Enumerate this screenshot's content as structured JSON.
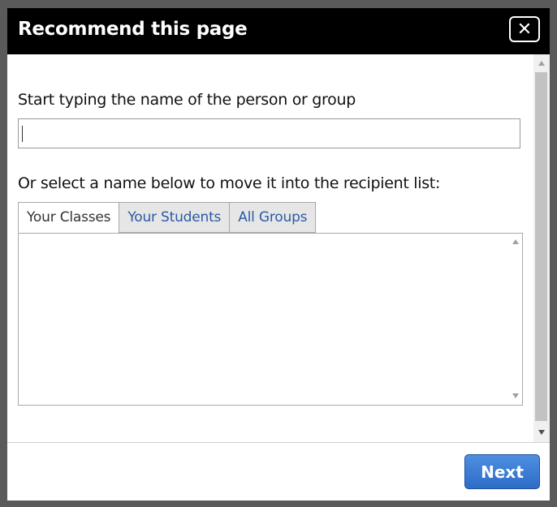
{
  "modal": {
    "title": "Recommend this page",
    "close_icon": "close-icon",
    "close_glyph": "✕",
    "prompt_label": "Start typing the name of the person or group",
    "search": {
      "value": "",
      "placeholder": ""
    },
    "select_label": "Or select a name below to move it into the recipient list:",
    "tabs": [
      {
        "label": "Your Classes",
        "active": true
      },
      {
        "label": "Your Students",
        "active": false
      },
      {
        "label": "All Groups",
        "active": false
      }
    ],
    "next_label": "Next"
  },
  "colors": {
    "header_bg": "#000000",
    "tab_link": "#2a5aa5",
    "button_blue": "#2e6cc8"
  }
}
